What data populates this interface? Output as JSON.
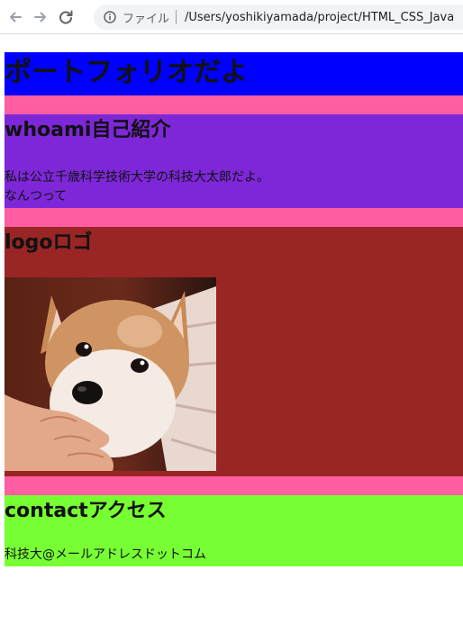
{
  "browser": {
    "scheme_label": "ファイル",
    "url": "/Users/yoshikiyamada/project/HTML_CSS_Java"
  },
  "header": {
    "title": "ポートフォリオだよ"
  },
  "whoami": {
    "title": "whoami自己紹介",
    "line1": "私は公立千歳科学技術大学の科技大太郎だよ。",
    "line2": "なんつって"
  },
  "logo": {
    "title": "logoロゴ",
    "image_subject": "shiba-inu-puppy"
  },
  "contact": {
    "title": "contactアクセス",
    "email": "科技大@メールアドレスドットコム"
  },
  "colors": {
    "header_bg": "#0000ff",
    "gap_bg": "#ff5ea2",
    "whoami_bg": "#7d27d8",
    "logo_bg": "#992525",
    "contact_bg": "#77ff33"
  }
}
